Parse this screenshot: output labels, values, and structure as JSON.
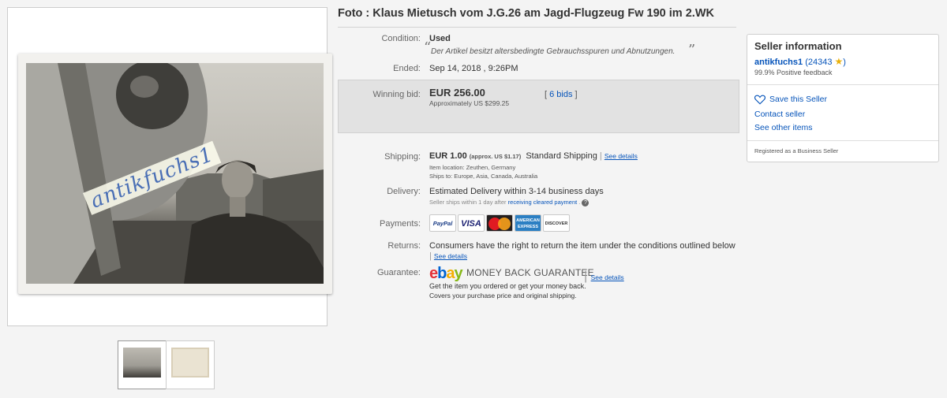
{
  "listing": {
    "title": "Foto : Klaus Mietusch vom J.G.26 am Jagd-Flugzeug Fw 190 im 2.WK",
    "photo_watermark": "antikfuchs1"
  },
  "details": {
    "condition_label": "Condition:",
    "condition_value": "Used",
    "condition_description": "Der Artikel besitzt altersbedingte Gebrauchsspuren und Abnutzungen.",
    "ended_label": "Ended:",
    "ended_value": "Sep 14, 2018 , 9:26PM",
    "winning_bid_label": "Winning bid:",
    "winning_bid_value": "EUR 256.00",
    "approx_value": "Approximately US $299.25",
    "bids_link": "6 bids",
    "shipping_label": "Shipping:",
    "shipping_cost": "EUR 1.00",
    "shipping_approx": "(approx. US $1.17)",
    "shipping_method": "Standard Shipping",
    "see_details": "See details",
    "item_location": "Item location:  Zeuthen, Germany",
    "ships_to": "Ships to:  Europe, Asia, Canada, Australia",
    "delivery_label": "Delivery:",
    "delivery_value": "Estimated Delivery within 3-14 business days",
    "delivery_note": "Seller ships within 1 day after",
    "delivery_note_link": "receiving cleared payment",
    "payments_label": "Payments:",
    "payment_logos": [
      "PayPal",
      "VISA",
      "MasterCard",
      "AMERICAN EXPRESS",
      "DISCOVER"
    ],
    "returns_label": "Returns:",
    "returns_value": "Consumers have the right to return the item under the conditions outlined below",
    "guarantee_label": "Guarantee:",
    "guarantee_name": "MONEY BACK GUARANTEE",
    "guarantee_line1": "Get the item you ordered or get your money back.",
    "guarantee_line2": "Covers your purchase price and original shipping."
  },
  "seller": {
    "title": "Seller information",
    "name": "antikfuchs1",
    "feedback_count": "(24343",
    "positive": "99.9% Positive feedback",
    "save_seller": "Save this Seller",
    "contact": "Contact seller",
    "other_items": "See other items",
    "registered": "Registered as a Business Seller"
  },
  "colors": {
    "link": "#0654ba",
    "bid_box": "#e2e2e2",
    "star": "#e9b10b"
  }
}
